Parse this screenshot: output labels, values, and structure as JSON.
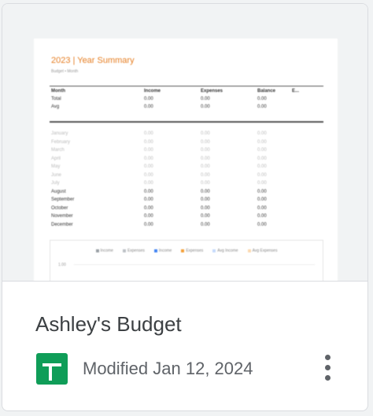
{
  "file": {
    "title": "Ashley's Budget",
    "modified_label": "Modified",
    "modified_date": "Jan 12, 2024",
    "icon": "google-sheets-icon",
    "menu_icon": "more-vert-icon"
  },
  "thumbnail": {
    "title": "2023 | Year Summary",
    "subtitle": "Budget • Month",
    "headers": [
      "Month",
      "Income",
      "Expenses",
      "Balance",
      "E..."
    ],
    "summary_rows": [
      [
        "Total",
        "0.00",
        "0.00",
        "0.00"
      ],
      [
        "Avg",
        "0.00",
        "0.00",
        "0.00"
      ]
    ],
    "month_rows": [
      [
        "January",
        "0.00",
        "0.00",
        "0.00"
      ],
      [
        "February",
        "0.00",
        "0.00",
        "0.00"
      ],
      [
        "March",
        "0.00",
        "0.00",
        "0.00"
      ],
      [
        "April",
        "0.00",
        "0.00",
        "0.00"
      ],
      [
        "May",
        "0.00",
        "0.00",
        "0.00"
      ],
      [
        "June",
        "0.00",
        "0.00",
        "0.00"
      ],
      [
        "July",
        "0.00",
        "0.00",
        "0.00"
      ],
      [
        "August",
        "0.00",
        "0.00",
        "0.00"
      ],
      [
        "September",
        "0.00",
        "0.00",
        "0.00"
      ],
      [
        "October",
        "0.00",
        "0.00",
        "0.00"
      ],
      [
        "November",
        "0.00",
        "0.00",
        "0.00"
      ],
      [
        "December",
        "0.00",
        "0.00",
        "0.00"
      ]
    ],
    "legend": [
      {
        "label": "Income",
        "color": "#9aa0a6"
      },
      {
        "label": "Expenses",
        "color": "#bdc1c6"
      },
      {
        "label": "Income",
        "color": "#4285f4"
      },
      {
        "label": "Expenses",
        "color": "#f4a03b"
      },
      {
        "label": "Avg Income",
        "color": "#c6dafc"
      },
      {
        "label": "Avg Expenses",
        "color": "#fcd9b0"
      }
    ],
    "chart_axis": "1.00",
    "colors": {
      "title": "#e67e22",
      "icon": "#0f9d58"
    }
  }
}
